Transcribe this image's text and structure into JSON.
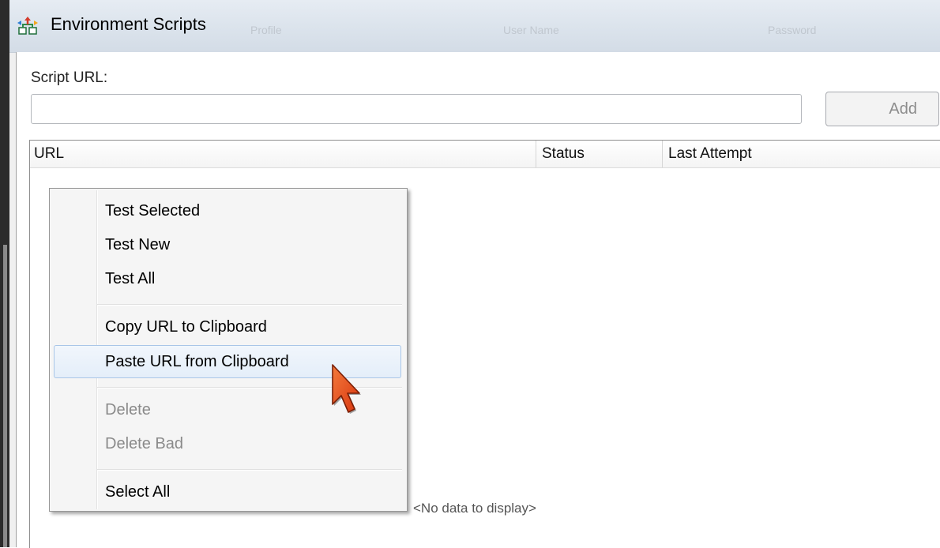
{
  "window": {
    "title": "Environment Scripts",
    "background_columns": [
      "Profile",
      "User Name",
      "Password"
    ]
  },
  "form": {
    "script_url_label": "Script URL:",
    "script_url_value": "",
    "add_label": "Add"
  },
  "grid": {
    "columns": [
      "URL",
      "Status",
      "Last Attempt"
    ],
    "empty_text": "<No data to display>"
  },
  "context_menu": {
    "items": [
      {
        "label": "Test Selected",
        "enabled": true
      },
      {
        "label": "Test New",
        "enabled": true
      },
      {
        "label": "Test All",
        "enabled": true
      },
      {
        "label": "Copy URL to Clipboard",
        "enabled": true
      },
      {
        "label": "Paste URL from Clipboard",
        "enabled": true,
        "highlighted": true
      },
      {
        "label": "Delete",
        "enabled": false
      },
      {
        "label": "Delete Bad",
        "enabled": false
      },
      {
        "label": "Select All",
        "enabled": true
      }
    ]
  },
  "colors": {
    "menu_highlight_border": "#a9c6e8",
    "cursor": "#e8451a"
  },
  "icons": {
    "app": "network-arrows-icon",
    "pointer": "arrow-cursor-icon"
  }
}
